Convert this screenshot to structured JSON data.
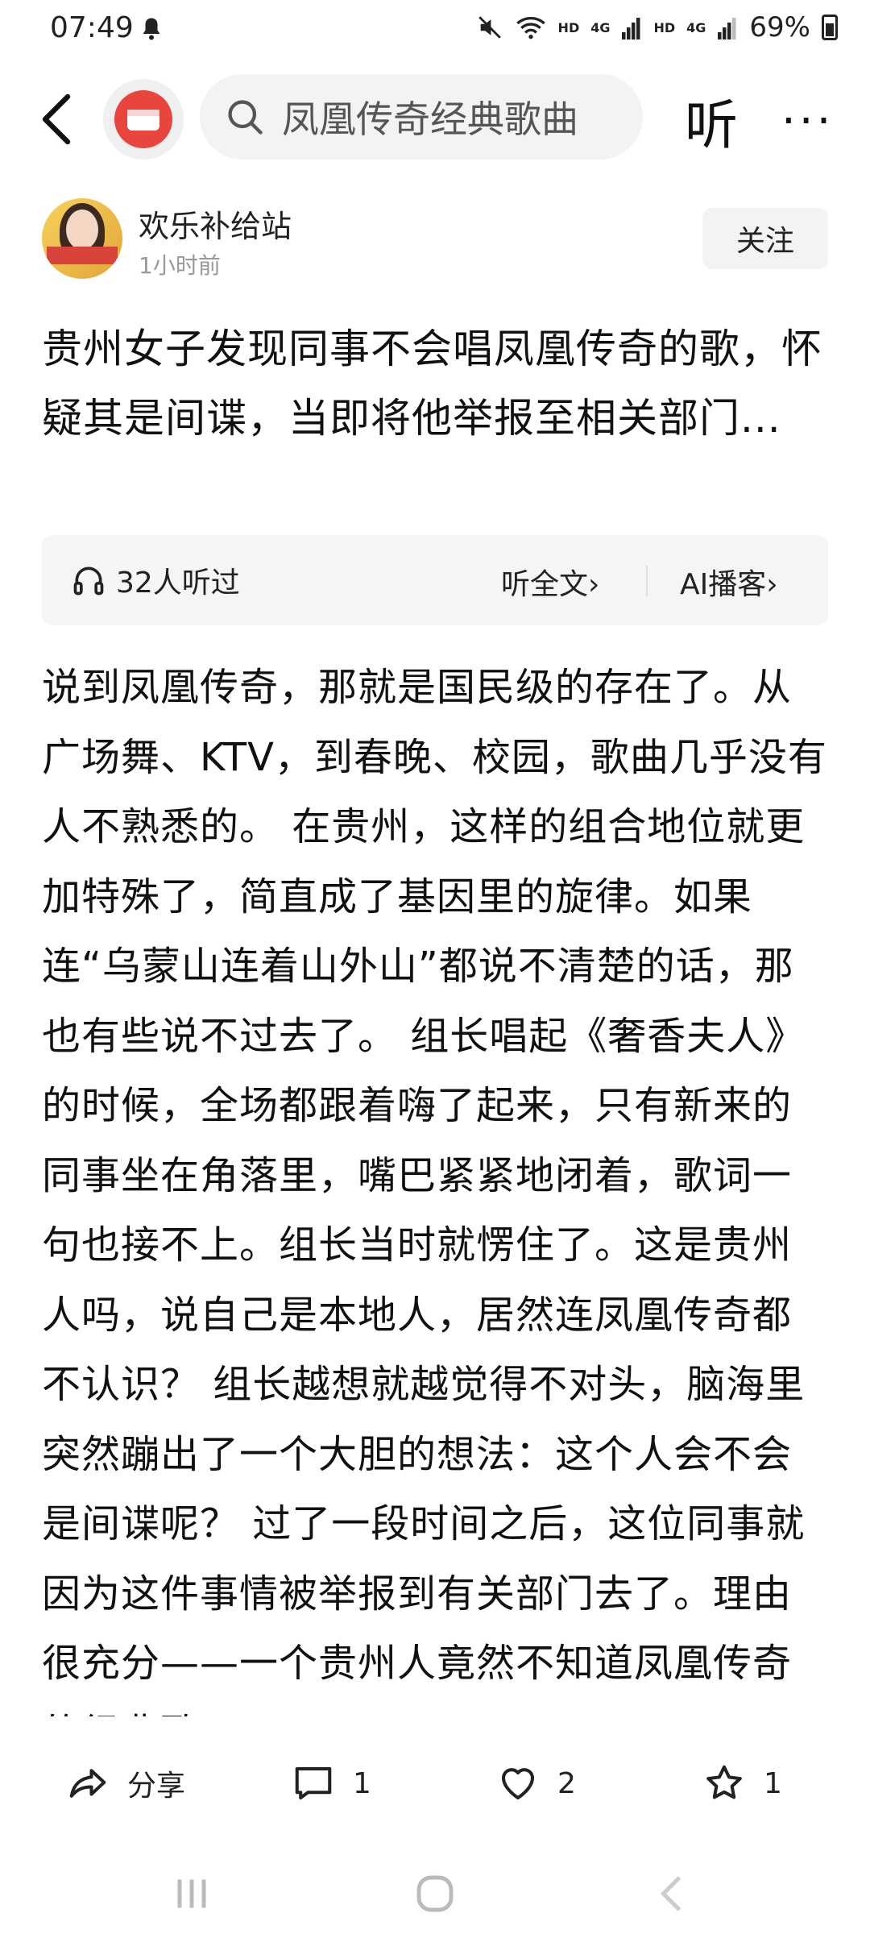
{
  "status_bar": {
    "time": "07:49",
    "battery": "69%",
    "network_labels": [
      "HD",
      "4G",
      "HD",
      "4G"
    ]
  },
  "top_nav": {
    "search_value": "凤凰传奇经典歌曲",
    "listen_label": "听",
    "more_label": "···"
  },
  "author": {
    "name": "欢乐补给站",
    "time": "1小时前",
    "follow_label": "关注"
  },
  "article": {
    "title": "贵州女子发现同事不会唱凤凰传奇的歌，怀疑其是间谍，当即将他举报至相关部门...",
    "body": "说到凤凰传奇，那就是国民级的存在了。从广场舞、KTV，到春晚、校园，歌曲几乎没有人不熟悉的。 在贵州，这样的组合地位就更加特殊了，简直成了基因里的旋律。如果连“乌蒙山连着山外山”都说不清楚的话，那也有些说不过去了。 组长唱起《奢香夫人》的时候，全场都跟着嗨了起来，只有新来的同事坐在角落里，嘴巴紧紧地闭着，歌词一句也接不上。组长当时就愣住了。这是贵州人吗，说自己是本地人，居然连凤凰传奇都不认识？ 组长越想就越觉得不对头，脑海里突然蹦出了一个大胆的想法：这个人会不会是间谍呢？ 过了一段时间之后，这位同事就因为这件事情被举报到有关部门去了。理由很充分——一个贵州人竟然不知道凤凰传奇的经典歌"
  },
  "audio": {
    "listeners": "32人听过",
    "full_text_label": "听全文",
    "ai_label": "AI播客",
    "arrow": "›"
  },
  "actions": {
    "share_label": "分享",
    "comment_count": "1",
    "like_count": "2",
    "favorite_count": "1"
  }
}
